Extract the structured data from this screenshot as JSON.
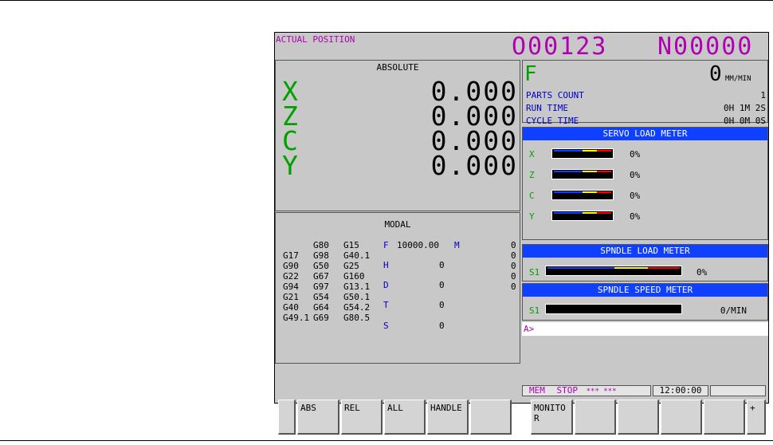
{
  "header": {
    "mode_title": "ACTUAL POSITION",
    "program_number": "O00123",
    "sequence_number": "N00000"
  },
  "absolute": {
    "title": "ABSOLUTE",
    "axes": [
      {
        "name": "X",
        "value": "0.000"
      },
      {
        "name": "Z",
        "value": "0.000"
      },
      {
        "name": "C",
        "value": "0.000"
      },
      {
        "name": "Y",
        "value": "0.000"
      }
    ]
  },
  "feed": {
    "label": "F",
    "value": "0",
    "unit": "MM/MIN",
    "rows": [
      {
        "label": "PARTS COUNT",
        "value": "1"
      },
      {
        "label": "RUN TIME",
        "value": "0H 1M 2S"
      },
      {
        "label": "CYCLE TIME",
        "value": "0H 0M 0S"
      }
    ]
  },
  "servo_meter": {
    "title": "SERVO LOAD METER",
    "axes": [
      {
        "name": "X",
        "percent": "0%"
      },
      {
        "name": "Z",
        "percent": "0%"
      },
      {
        "name": "C",
        "percent": "0%"
      },
      {
        "name": "Y",
        "percent": "0%"
      }
    ]
  },
  "spindle_load": {
    "title": "SPNDLE LOAD METER",
    "label": "S1",
    "percent": "0%"
  },
  "spindle_speed": {
    "title": "SPNDLE SPEED METER",
    "label": "S1",
    "value": "0/MIN"
  },
  "input_prompt": "A>",
  "modal": {
    "title": "MODAL",
    "gcodes": [
      [
        "",
        "G80",
        "G15"
      ],
      [
        "G17",
        "G98",
        "G40.1"
      ],
      [
        "G90",
        "G50",
        "G25"
      ],
      [
        "G22",
        "G67",
        "G160"
      ],
      [
        "G94",
        "G97",
        "G13.1"
      ],
      [
        "G21",
        "G54",
        "G50.1"
      ],
      [
        "G40",
        "G64",
        "G54.2"
      ],
      [
        "G49.1",
        "G69",
        "G80.5"
      ]
    ],
    "letters": [
      {
        "letter": "F",
        "value": "10000.00"
      },
      {
        "letter": "H",
        "value": "0"
      },
      {
        "letter": "D",
        "value": "0"
      },
      {
        "letter": "T",
        "value": "0"
      },
      {
        "letter": "S",
        "value": "0"
      }
    ],
    "m_label": "M",
    "m_values": [
      "0",
      "0",
      "0",
      "0",
      "0"
    ]
  },
  "status": {
    "mode": "MEM",
    "state": "STOP",
    "stars": "*** ***",
    "time": "12:00:00"
  },
  "softkeys": [
    "ABS",
    "REL",
    "ALL",
    "HANDLE",
    "",
    "MONITO\nR",
    "",
    "",
    "",
    "",
    "+"
  ],
  "colors": {
    "background": "#c8c8c8",
    "header_magenta": "#b000b0",
    "axis_green": "#00a000",
    "meter_header_blue": "#1040ff",
    "label_blue": "#0000c8"
  }
}
